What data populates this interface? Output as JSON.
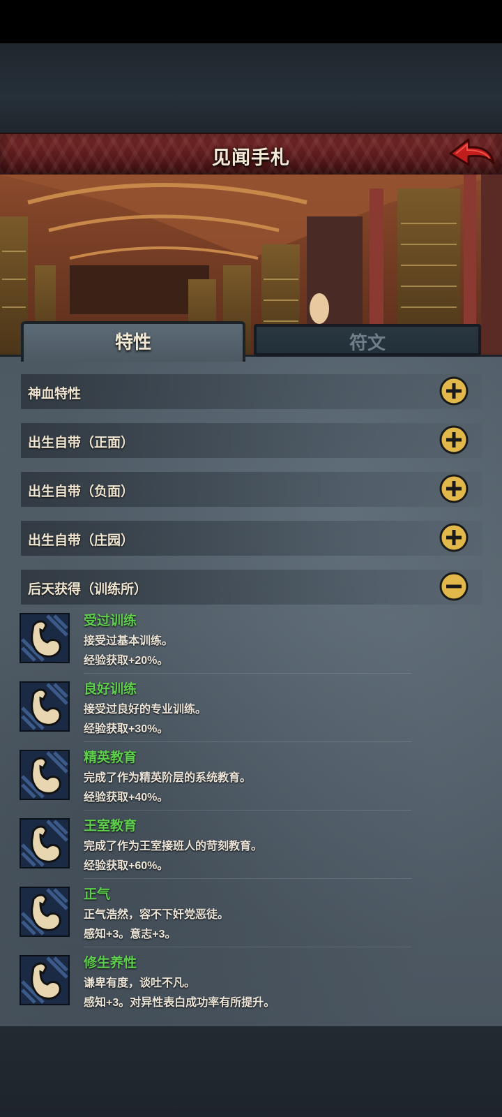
{
  "header": {
    "title": "见闻手札",
    "back_icon": "back-arrow-icon"
  },
  "tabs": [
    {
      "label": "特性",
      "active": true
    },
    {
      "label": "符文",
      "active": false
    }
  ],
  "sections": [
    {
      "label": "神血特性",
      "state": "collapsed",
      "toggle_icon": "plus-circle-icon"
    },
    {
      "label": "出生自带（正面）",
      "state": "collapsed",
      "toggle_icon": "plus-circle-icon"
    },
    {
      "label": "出生自带（负面）",
      "state": "collapsed",
      "toggle_icon": "plus-circle-icon"
    },
    {
      "label": "出生自带（庄园）",
      "state": "collapsed",
      "toggle_icon": "plus-circle-icon"
    },
    {
      "label": "后天获得（训练所）",
      "state": "expanded",
      "toggle_icon": "minus-circle-icon"
    }
  ],
  "traits": [
    {
      "name": "受过训练",
      "desc": "接受过基本训练。",
      "effect": "经验获取+20%。",
      "icon": "flexed-arm-icon"
    },
    {
      "name": "良好训练",
      "desc": "接受过良好的专业训练。",
      "effect": "经验获取+30%。",
      "icon": "flexed-arm-icon"
    },
    {
      "name": "精英教育",
      "desc": "完成了作为精英阶层的系统教育。",
      "effect": "经验获取+40%。",
      "icon": "flexed-arm-icon"
    },
    {
      "name": "王室教育",
      "desc": "完成了作为王室接班人的苛刻教育。",
      "effect": "经验获取+60%。",
      "icon": "flexed-arm-icon"
    },
    {
      "name": "正气",
      "desc": "正气浩然，容不下奸党恶徒。",
      "effect": "感知+3。意志+3。",
      "icon": "flexed-arm-icon"
    },
    {
      "name": "修生养性",
      "desc": "谦卑有度，谈吐不凡。",
      "effect": "感知+3。对异性表白成功率有所提升。",
      "icon": "flexed-arm-icon"
    }
  ],
  "colors": {
    "trait_name": "#5fd04e",
    "header_red": "#6a2224",
    "toggle_gold": "#e2b84a"
  }
}
